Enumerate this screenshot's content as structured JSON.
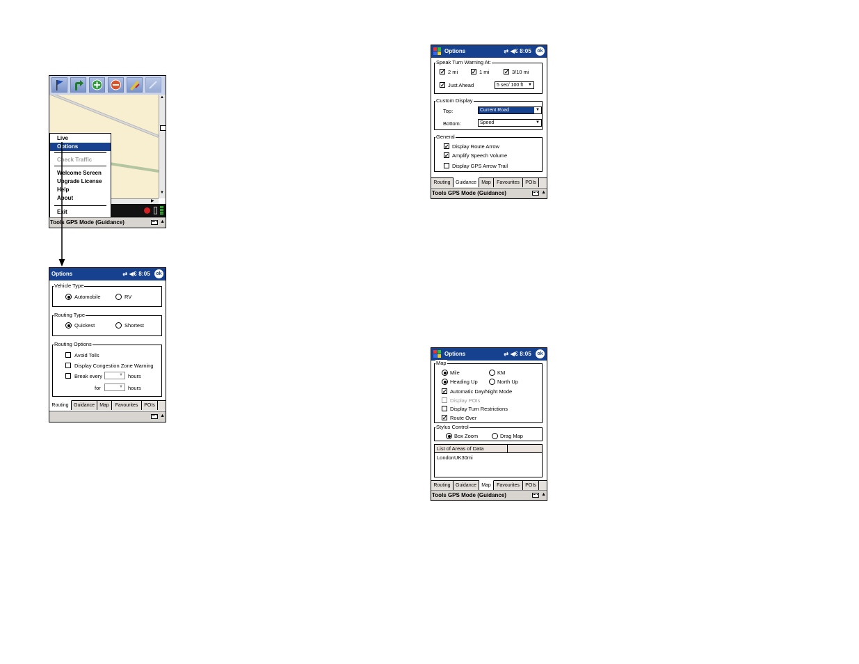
{
  "colors": {
    "title_bar": "#16418f",
    "selection": "#16418f",
    "map_bg": "#f7efcf",
    "map_road": "#b3c6a1"
  },
  "common": {
    "ok_label": "ok",
    "time": "8:05",
    "status_icons": "⇄ ◀€",
    "command_bar": "Tools  GPS Mode (Guidance)",
    "command_bar_short": "Tools GPS Mode (Guidance)"
  },
  "tabs": {
    "routing": "Routing",
    "guidance": "Guidance",
    "map": "Map",
    "favourites": "Favourites",
    "pois": "POIs"
  },
  "map_screen": {
    "menu": {
      "items": [
        "Live",
        "Options",
        "Check Traffic",
        "Welcome Screen",
        "Upgrade License",
        "Help",
        "About",
        "Exit"
      ],
      "selected": "Options",
      "disabled": "Check Traffic"
    },
    "toolbar_icons": [
      "flag-icon",
      "turn-arrow-icon",
      "zoom-in-icon",
      "zoom-out-icon",
      "ruler-pencil-icon",
      "pencil-icon"
    ]
  },
  "routing_screen": {
    "title": "Options",
    "vehicle_type": {
      "legend": "Vehicle Type",
      "options": [
        "Automobile",
        "RV"
      ],
      "selected": "Automobile"
    },
    "routing_type": {
      "legend": "Routing Type",
      "options": [
        "Quickest",
        "Shortest"
      ],
      "selected": "Quickest"
    },
    "routing_options": {
      "legend": "Routing Options",
      "avoid_tolls": "Avoid Tolls",
      "congestion": "Display Congestion Zone Warning",
      "break_every": "Break every",
      "for": "for",
      "hours": "hours"
    }
  },
  "guidance_screen": {
    "title": "Options",
    "speak": {
      "legend": "Speak Turn Warning At:",
      "distances": [
        "2 mi",
        "1 mi",
        "3/10 mi"
      ],
      "just_ahead": "Just Ahead",
      "just_ahead_value": "5 sec/ 100 ft"
    },
    "custom": {
      "legend": "Custom Display",
      "top_label": "Top:",
      "top_value": "Current Road",
      "bottom_label": "Bottom:",
      "bottom_value": "Speed"
    },
    "general": {
      "legend": "General",
      "items": [
        "Display Route Arrow",
        "Amplify Speech Volume",
        "Display GPS Arrow Trail"
      ],
      "checked": [
        true,
        true,
        false
      ]
    }
  },
  "map_options_screen": {
    "title": "Options",
    "map": {
      "legend": "Map",
      "mile": "Mile",
      "km": "KM",
      "heading_up": "Heading Up",
      "north_up": "North Up",
      "checks": [
        "Automatic Day/Night Mode",
        "Display POIs",
        "Display Turn Restrictions",
        "Route Over"
      ],
      "checked": [
        true,
        false,
        false,
        true
      ],
      "disabled": [
        false,
        true,
        false,
        false
      ]
    },
    "stylus": {
      "legend": "Stylus Control",
      "options": [
        "Box Zoom",
        "Drag Map"
      ],
      "selected": "Box Zoom"
    },
    "areas": {
      "header": "List of Areas of Data",
      "rows": [
        "LondonUK30mi"
      ]
    }
  }
}
